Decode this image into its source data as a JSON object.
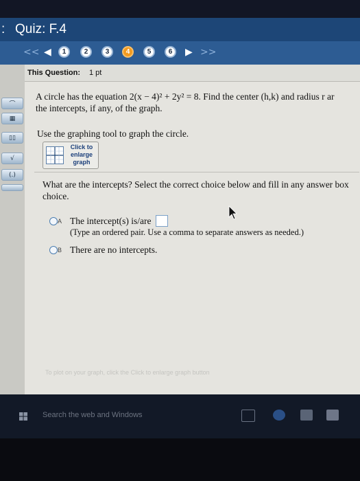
{
  "window": {
    "title": "Quiz: F.4",
    "prefix": ":"
  },
  "nav": {
    "back_double": "<<",
    "back": "◀",
    "questions": [
      "1",
      "2",
      "3",
      "4",
      "5",
      "6"
    ],
    "current": "4",
    "next": "▶",
    "next_double": ">>"
  },
  "question_header": {
    "label": "This Question:",
    "points": "1 pt"
  },
  "question": {
    "line1": "A circle has the equation 2(x − 4)² + 2y² = 8. Find the center (h,k) and radius r ar",
    "line2": "the intercepts, if any, of the graph.",
    "instruction": "Use the graphing tool to graph the circle.",
    "graph_button": "Click to enlarge graph"
  },
  "part2": {
    "line1": "What are the intercepts? Select the correct choice below and fill in any answer box",
    "line2": "choice."
  },
  "options": [
    {
      "letter": "A",
      "text": "The intercept(s) is/are",
      "hint": "(Type an ordered pair. Use a comma to separate answers as needed.)"
    },
    {
      "letter": "B",
      "text": "There are no intercepts."
    }
  ],
  "faint_footer": "To plot on your graph, click the Click to enlarge graph button",
  "taskbar": {
    "search_placeholder": "Search the web and Windows"
  },
  "colors": {
    "titlebar": "#1d4677",
    "navbar": "#2d5c93",
    "active_question": "#f39a1e"
  }
}
